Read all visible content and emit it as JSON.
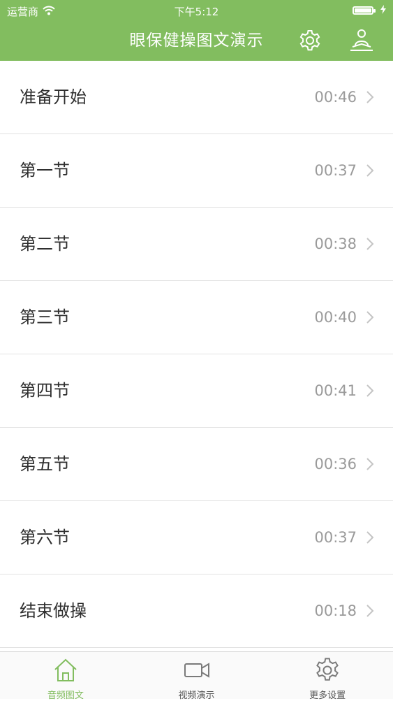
{
  "status_bar": {
    "carrier": "运营商",
    "time": "下午5:12"
  },
  "nav": {
    "title": "眼保健操图文演示",
    "settings_icon": "gear-icon",
    "profile_icon": "meditation-person-icon"
  },
  "colors": {
    "brand_green": "#82bd5f",
    "row_text": "#2f2f2f",
    "duration_text": "#9a9a9a"
  },
  "sections": [
    {
      "name": "准备开始",
      "duration": "00:46"
    },
    {
      "name": "第一节",
      "duration": "00:37"
    },
    {
      "name": "第二节",
      "duration": "00:38"
    },
    {
      "name": "第三节",
      "duration": "00:40"
    },
    {
      "name": "第四节",
      "duration": "00:41"
    },
    {
      "name": "第五节",
      "duration": "00:36"
    },
    {
      "name": "第六节",
      "duration": "00:37"
    },
    {
      "name": "结束做操",
      "duration": "00:18"
    }
  ],
  "tabbar": {
    "tabs": [
      {
        "label": "音频图文",
        "icon": "home-icon",
        "active": true
      },
      {
        "label": "视频演示",
        "icon": "video-camera-icon",
        "active": false
      },
      {
        "label": "更多设置",
        "icon": "gear-icon",
        "active": false
      }
    ]
  }
}
